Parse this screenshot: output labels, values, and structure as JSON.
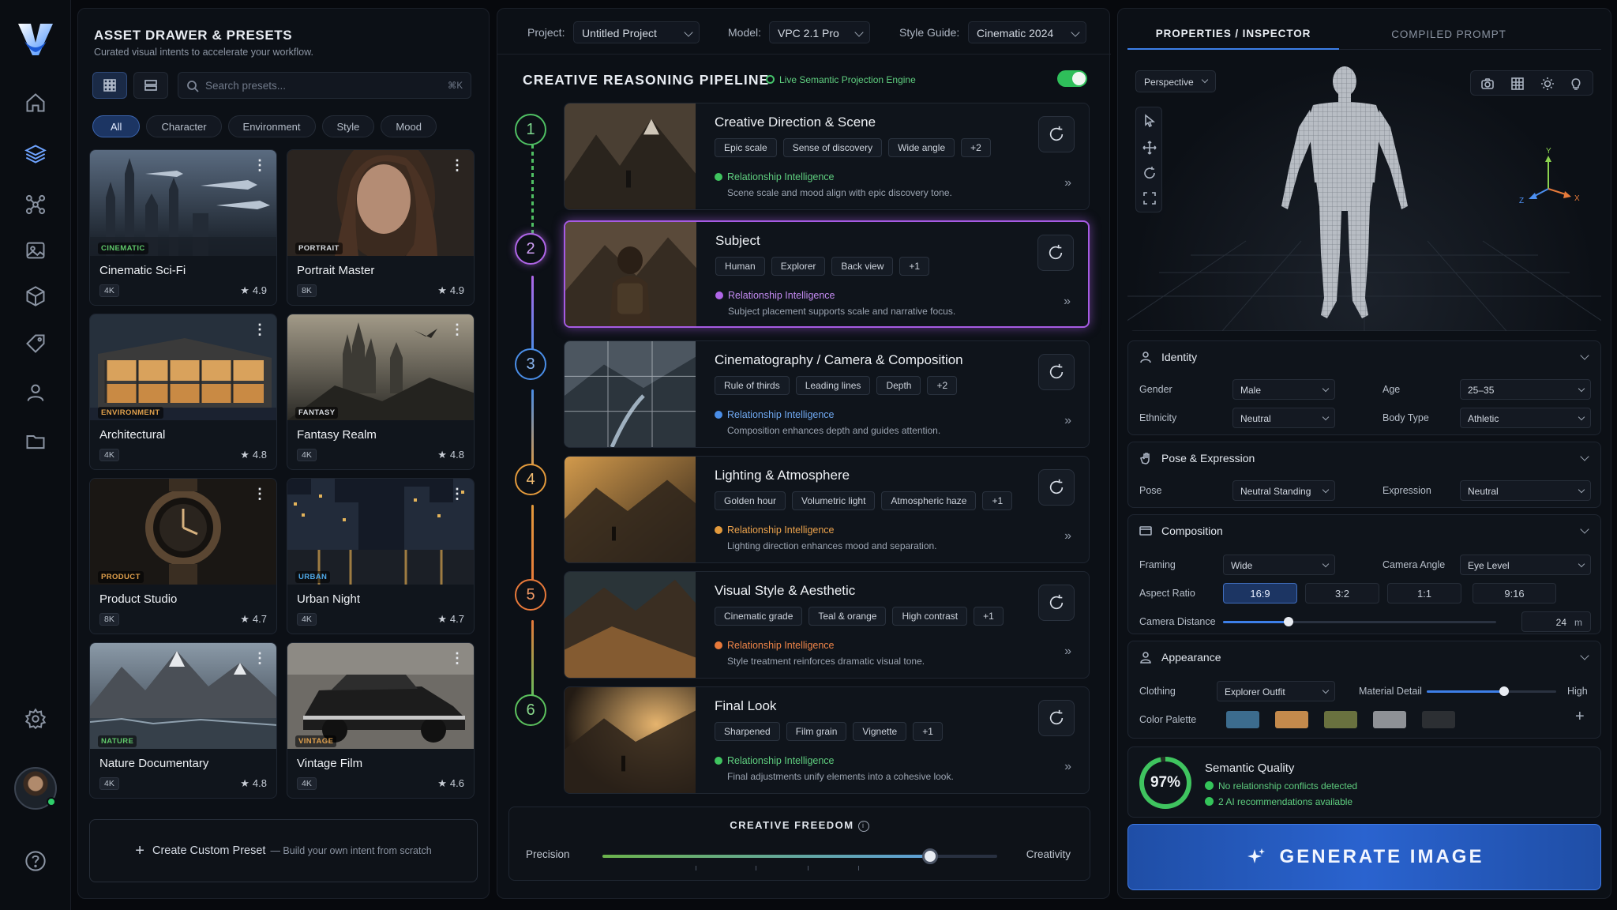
{
  "left": {
    "title": "ASSET DRAWER & PRESETS",
    "subtitle": "Curated visual intents to accelerate your workflow.",
    "search_placeholder": "Search presets...",
    "search_shortcut": "⌘K",
    "filters": [
      "All",
      "Character",
      "Environment",
      "Style",
      "Mood"
    ],
    "presets": [
      {
        "tag": "CINEMATIC",
        "name": "Cinematic Sci-Fi",
        "res": "4K",
        "rating": "4.9"
      },
      {
        "tag": "PORTRAIT",
        "name": "Portrait Master",
        "res": "8K",
        "rating": "4.9"
      },
      {
        "tag": "ENVIRONMENT",
        "name": "Architectural",
        "res": "4K",
        "rating": "4.8"
      },
      {
        "tag": "FANTASY",
        "name": "Fantasy Realm",
        "res": "4K",
        "rating": "4.8"
      },
      {
        "tag": "PRODUCT",
        "name": "Product Studio",
        "res": "8K",
        "rating": "4.7"
      },
      {
        "tag": "URBAN",
        "name": "Urban Night",
        "res": "4K",
        "rating": "4.7"
      },
      {
        "tag": "NATURE",
        "name": "Nature Documentary",
        "res": "4K",
        "rating": "4.8"
      },
      {
        "tag": "VINTAGE",
        "name": "Vintage Film",
        "res": "4K",
        "rating": "4.6"
      }
    ],
    "create_label": "Create Custom Preset",
    "create_sub": "— Build your own intent from scratch"
  },
  "top": {
    "project_label": "Project:",
    "project": "Untitled Project",
    "model_label": "Model:",
    "model": "VPC 2.1 Pro",
    "guide_label": "Style Guide:",
    "guide": "Cinematic 2024"
  },
  "pipeline": {
    "title": "CREATIVE REASONING PIPELINE",
    "engine": "Live Semantic Projection Engine",
    "ri_label": "Relationship Intelligence",
    "steps": [
      {
        "num": "1",
        "title": "Creative Direction & Scene",
        "tags": [
          "Epic scale",
          "Sense of discovery",
          "Wide angle",
          "+2"
        ],
        "desc": "Scene scale and mood align with epic discovery tone.",
        "color": "#4fbf63"
      },
      {
        "num": "2",
        "title": "Subject",
        "tags": [
          "Human",
          "Explorer",
          "Back view",
          "+1"
        ],
        "desc": "Subject placement supports scale and narrative focus.",
        "color": "#b066e8"
      },
      {
        "num": "3",
        "title": "Cinematography / Camera & Composition",
        "tags": [
          "Rule of thirds",
          "Leading lines",
          "Depth",
          "+2"
        ],
        "desc": "Composition enhances depth and guides attention.",
        "color": "#4a8ee8"
      },
      {
        "num": "4",
        "title": "Lighting & Atmosphere",
        "tags": [
          "Golden hour",
          "Volumetric light",
          "Atmospheric haze",
          "+1"
        ],
        "desc": "Lighting direction enhances mood and separation.",
        "color": "#e39a3c"
      },
      {
        "num": "5",
        "title": "Visual Style & Aesthetic",
        "tags": [
          "Cinematic grade",
          "Teal & orange",
          "High contrast",
          "+1"
        ],
        "desc": "Style treatment reinforces dramatic visual tone.",
        "color": "#e8793a"
      },
      {
        "num": "6",
        "title": "Final Look",
        "tags": [
          "Sharpened",
          "Film grain",
          "Vignette",
          "+1"
        ],
        "desc": "Final adjustments unify elements into a cohesive look.",
        "color": "#5cc25e"
      }
    ],
    "freedom_title": "CREATIVE FREEDOM",
    "freedom_left": "Precision",
    "freedom_right": "Creativity",
    "freedom_value": 0.83
  },
  "inspector": {
    "tab1": "PROPERTIES / INSPECTOR",
    "tab2": "COMPILED PROMPT",
    "view": "Perspective",
    "identity": {
      "title": "Identity",
      "gender_l": "Gender",
      "gender": "Male",
      "age_l": "Age",
      "age": "25–35",
      "eth_l": "Ethnicity",
      "eth": "Neutral",
      "body_l": "Body Type",
      "body": "Athletic"
    },
    "pose": {
      "title": "Pose & Expression",
      "pose_l": "Pose",
      "pose": "Neutral Standing",
      "expr_l": "Expression",
      "expr": "Neutral"
    },
    "comp": {
      "title": "Composition",
      "framing_l": "Framing",
      "framing": "Wide",
      "angle_l": "Camera Angle",
      "angle": "Eye Level",
      "aspect_l": "Aspect Ratio",
      "aspects": [
        "16:9",
        "3:2",
        "1:1",
        "9:16"
      ],
      "dist_l": "Camera Distance",
      "dist": "24",
      "dist_unit": "m",
      "dist_fraction": 0.24
    },
    "appearance": {
      "title": "Appearance",
      "clothing_l": "Clothing",
      "clothing": "Explorer Outfit",
      "detail_l": "Material Detail",
      "detail": "High",
      "detail_fraction": 0.6,
      "palette_l": "Color Palette",
      "palette": [
        "#3c6c8e",
        "#c48a4c",
        "#69713f",
        "#8e9196",
        "#2c2f33"
      ]
    },
    "quality": {
      "value": "97%",
      "title": "Semantic Quality",
      "l1": "No relationship conflicts detected",
      "l2": "2 AI recommendations available"
    },
    "generate": "GENERATE IMAGE"
  }
}
